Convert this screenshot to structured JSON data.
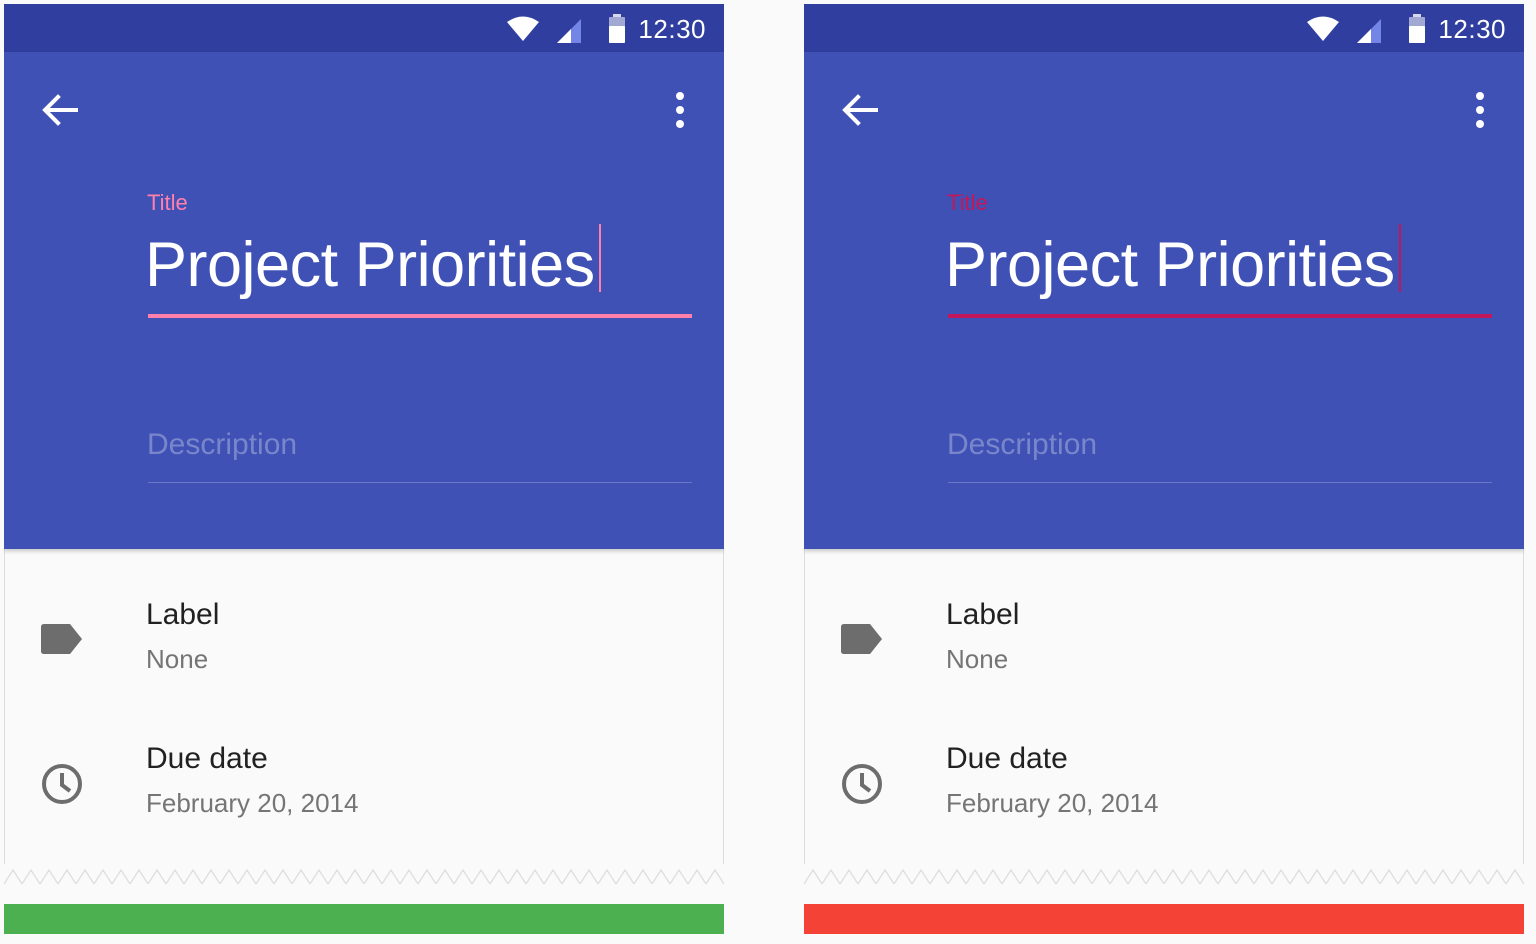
{
  "status_bar": {
    "time": "12:30"
  },
  "screens": [
    {
      "title_label": "Title",
      "title_value": "Project Priorities",
      "description_placeholder": "Description",
      "accent_color": "#ff80ab",
      "label_field": {
        "label": "Label",
        "value": "None"
      },
      "due_field": {
        "label": "Due date",
        "value": "February 20, 2014"
      },
      "verdict_color": "#4caf50"
    },
    {
      "title_label": "Title",
      "title_value": "Project Priorities",
      "description_placeholder": "Description",
      "accent_color": "#c2185b",
      "label_field": {
        "label": "Label",
        "value": "None"
      },
      "due_field": {
        "label": "Due date",
        "value": "February 20, 2014"
      },
      "verdict_color": "#f44336"
    }
  ],
  "colors": {
    "primary": "#3f51b5",
    "primary_dark": "#303f9f",
    "background": "#fafafa"
  },
  "icons": [
    "wifi-icon",
    "cell-signal-icon",
    "battery-icon",
    "back-arrow-icon",
    "more-vert-icon",
    "label-icon",
    "clock-icon"
  ]
}
